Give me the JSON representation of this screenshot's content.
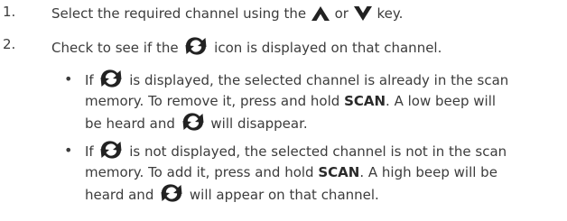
{
  "step1": {
    "number": "1.",
    "text_before": "Select the required channel using the ",
    "text_mid": " or ",
    "text_after": " key.",
    "icons": [
      "up-arrow-icon",
      "down-arrow-icon"
    ]
  },
  "step2": {
    "number": "2.",
    "text_before": "Check to see if the ",
    "text_after": " icon is displayed on that channel.",
    "icon": "scan-icon"
  },
  "bullets": [
    {
      "marker": "•",
      "p1": "If ",
      "p2": " is displayed, the selected channel is already in the scan memory. To remove it, press and hold ",
      "bold": "SCAN",
      "p3": ". A low beep will be heard and ",
      "p4": " will disappear."
    },
    {
      "marker": "•",
      "p1": "If ",
      "p2": " is not displayed, the selected channel is not in the scan memory. To add it, press and hold ",
      "bold": "SCAN",
      "p3": ". A high beep will be heard and ",
      "p4": " will appear on that channel."
    }
  ],
  "colors": {
    "text": "#3c3c3c",
    "icon": "#222222"
  }
}
